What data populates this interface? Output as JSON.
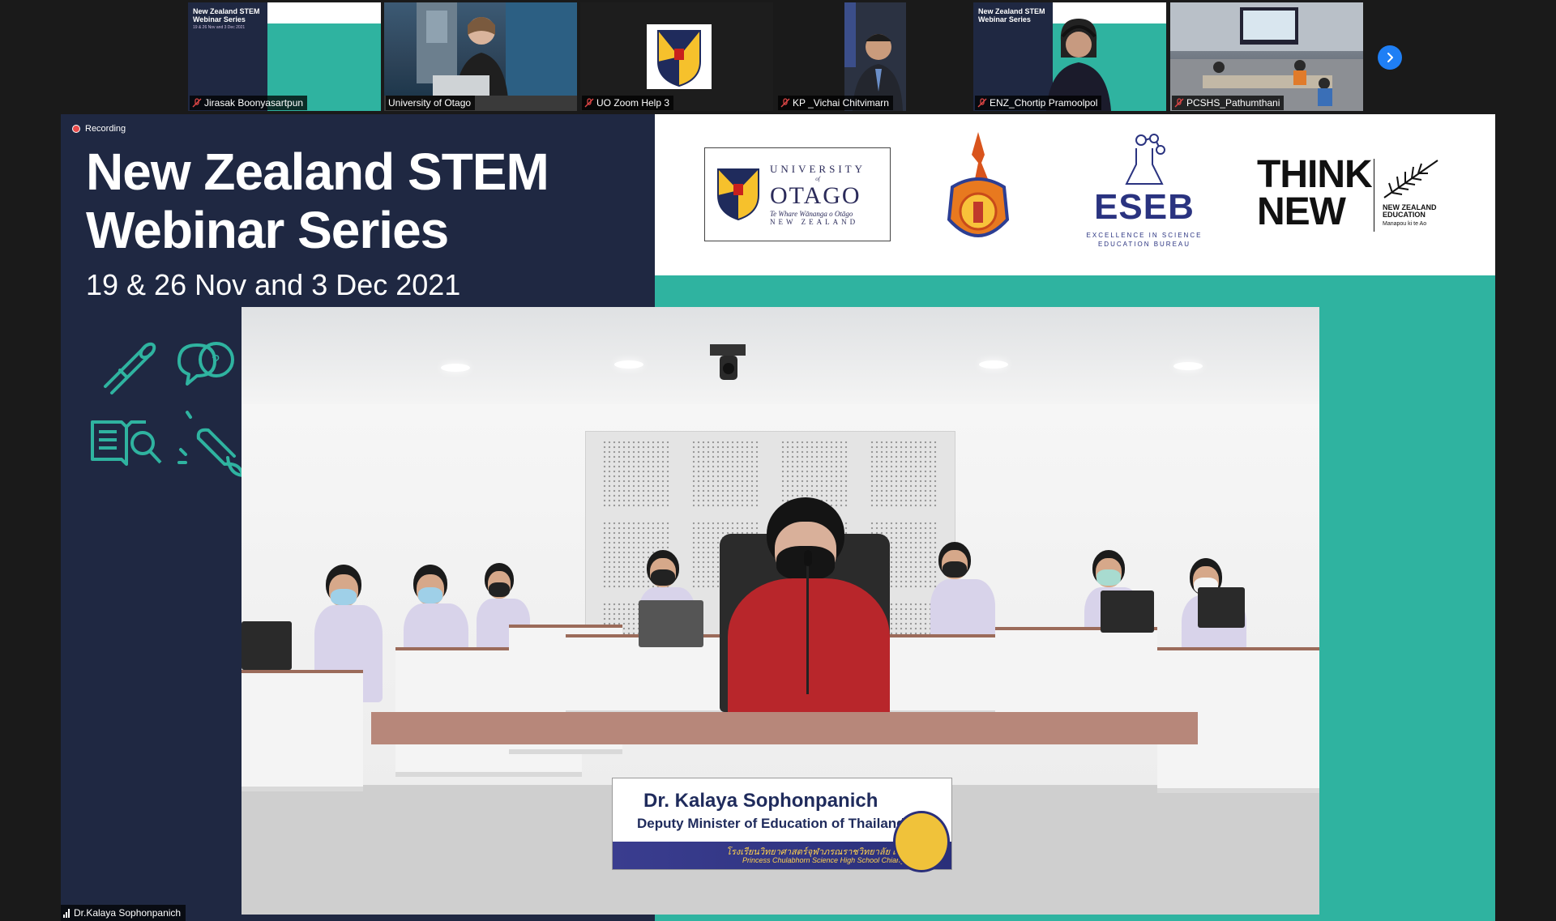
{
  "participants": [
    {
      "name": "Jirasak Boonyasartpun",
      "muted": true,
      "view": "shared-slide"
    },
    {
      "name": "University of Otago",
      "muted": false,
      "view": "video"
    },
    {
      "name": "UO Zoom Help 3",
      "muted": true,
      "view": "logo"
    },
    {
      "name": "KP _Vichai Chitvimarn",
      "muted": true,
      "view": "video"
    },
    {
      "name": "ENZ_Chortip Pramoolpol",
      "muted": true,
      "view": "video"
    },
    {
      "name": "PCSHS_Pathumthani",
      "muted": true,
      "view": "video"
    }
  ],
  "thumb_slide": {
    "title": "New Zealand STEM\nWebinar Series",
    "date": "19 & 26 Nov and 3 Dec 2021"
  },
  "status": {
    "recording_label": "Recording"
  },
  "slide": {
    "title": "New Zealand STEM\nWebinar Series",
    "date": "19 & 26 Nov and 3 Dec 2021",
    "colors": {
      "navy": "#1f2842",
      "teal": "#2fb3a0"
    }
  },
  "logos": {
    "otago_line1": "UNIVERSITY",
    "otago_line1b": "of",
    "otago_line2": "OTAGO",
    "otago_line3": "Te Whare Wānanga o Otāgo",
    "otago_line4": "NEW ZEALAND",
    "eseb_abbr": "ESEB",
    "eseb_full": "EXCELLENCE IN SCIENCE EDUCATION BUREAU",
    "think_new_1": "THINK",
    "think_new_2": "NEW",
    "nz_education": "NEW ZEALAND EDUCATION",
    "nz_maori": "Manapou ki te Ao"
  },
  "nameplate": {
    "name": "Dr. Kalaya Sophonpanich",
    "title": "Deputy Minister of Education of Thailand",
    "school_thai": "โรงเรียนวิทยาศาสตร์จุฬาภรณราชวิทยาลัย เชียงราย",
    "school_en": "Princess Chulabhorn Science High School Chiang Rai"
  },
  "active_speaker": {
    "name": "Dr.Kalaya Sophonpanich"
  },
  "controls": {
    "next_page_icon": "chevron-right-icon"
  }
}
